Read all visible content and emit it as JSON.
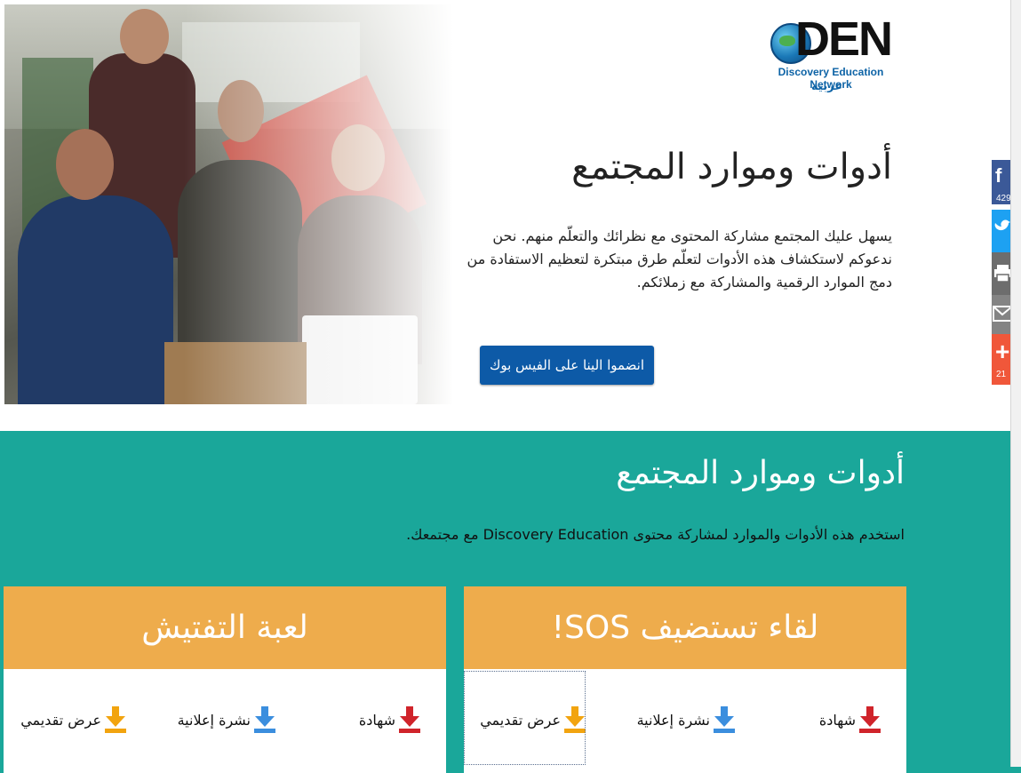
{
  "logo": {
    "mark": "DEN",
    "network": "Discovery Education Network",
    "region": "عربية"
  },
  "hero": {
    "title": "أدوات وموارد المجتمع",
    "description": "يسهل عليك المجتمع مشاركة المحتوى مع نظرائك والتعلّم منهم. نحن ندعوكم لاستكشاف هذه الأدوات لتعلّم طرق مبتكرة لتعظيم الاستفادة من دمج الموارد الرقمية والمشاركة مع زملائكم.",
    "button_label": "انضموا الينا على الفيس بوك"
  },
  "share_bar": [
    {
      "icon": "facebook-icon",
      "glyph": "f",
      "count": "429",
      "color": "#3b5998"
    },
    {
      "icon": "twitter-icon",
      "glyph": "",
      "count": "",
      "color": "#1da1f2"
    },
    {
      "icon": "print-icon",
      "glyph": "",
      "count": "",
      "color": "#6d6d6d"
    },
    {
      "icon": "email-icon",
      "glyph": "",
      "count": "",
      "color": "#848484"
    },
    {
      "icon": "plus-icon",
      "glyph": "+",
      "count": "21",
      "color": "#f0573a"
    }
  ],
  "section": {
    "title": "أدوات وموارد المجتمع",
    "subtitle": "استخدم هذه الأدوات والموارد لمشاركة محتوى Discovery Education مع مجتمعك."
  },
  "cards": [
    {
      "title": "لقاء تستضيف SOS!",
      "downloads": [
        {
          "label": "شهادة",
          "icon": "download-red-icon",
          "color": "#d0242b"
        },
        {
          "label": "نشرة إعلانية",
          "icon": "download-blue-icon",
          "color": "#3b8ede"
        },
        {
          "label": "عرض تقديمي",
          "icon": "download-orange-icon",
          "color": "#f2a40f"
        }
      ]
    },
    {
      "title": "لعبة التفتيش",
      "downloads": [
        {
          "label": "شهادة",
          "icon": "download-red-icon",
          "color": "#d0242b"
        },
        {
          "label": "نشرة إعلانية",
          "icon": "download-blue-icon",
          "color": "#3b8ede"
        },
        {
          "label": "عرض تقديمي",
          "icon": "download-orange-icon",
          "color": "#f2a40f"
        }
      ]
    }
  ]
}
